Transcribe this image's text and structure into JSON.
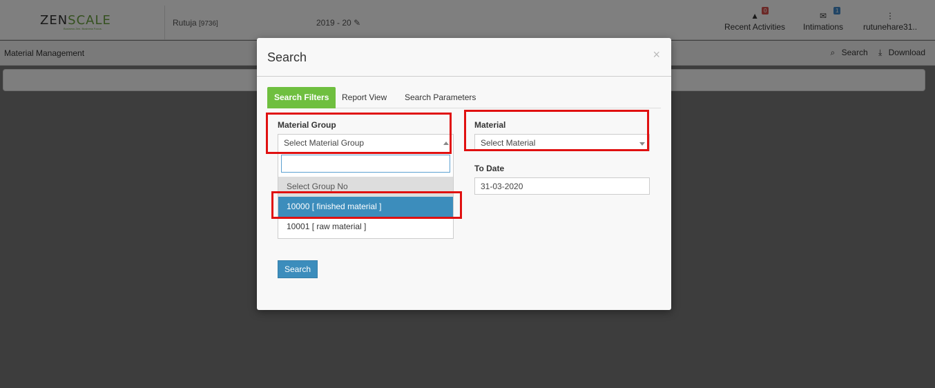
{
  "header": {
    "logo_pre": "ZEN",
    "logo_mid": "SC",
    "logo_accent": "A",
    "logo_post": "LE",
    "logo_tagline": "Business Zen. Business Focus.",
    "user_name": "Rutuja",
    "user_code": "[9736]",
    "fiscal_year": "2019 - 20",
    "recent_activities_label": "Recent Activities",
    "recent_activities_count": "0",
    "intimations_label": "Intimations",
    "intimations_count": "1",
    "account_label": "rutunehare31.."
  },
  "subbar": {
    "title": "Material Management",
    "search_label": "Search",
    "download_label": "Download"
  },
  "modal": {
    "title": "Search",
    "close": "×",
    "tabs": [
      {
        "label": "Search Filters",
        "active": true
      },
      {
        "label": "Report View",
        "active": false
      },
      {
        "label": "Search Parameters",
        "active": false
      }
    ],
    "material_group": {
      "label": "Material Group",
      "value": "Select Material Group",
      "options": [
        {
          "label": "Select Group No"
        },
        {
          "label": "10000 [ finished material ]"
        },
        {
          "label": "10001 [ raw material ]"
        }
      ]
    },
    "material": {
      "label": "Material",
      "value": "Select Material"
    },
    "to_date": {
      "label": "To Date",
      "value": "31-03-2020"
    },
    "search_button": "Search"
  },
  "colors": {
    "accent_green": "#6fbf3f",
    "primary_blue": "#3c8dbc",
    "highlight_red": "#e01010"
  }
}
